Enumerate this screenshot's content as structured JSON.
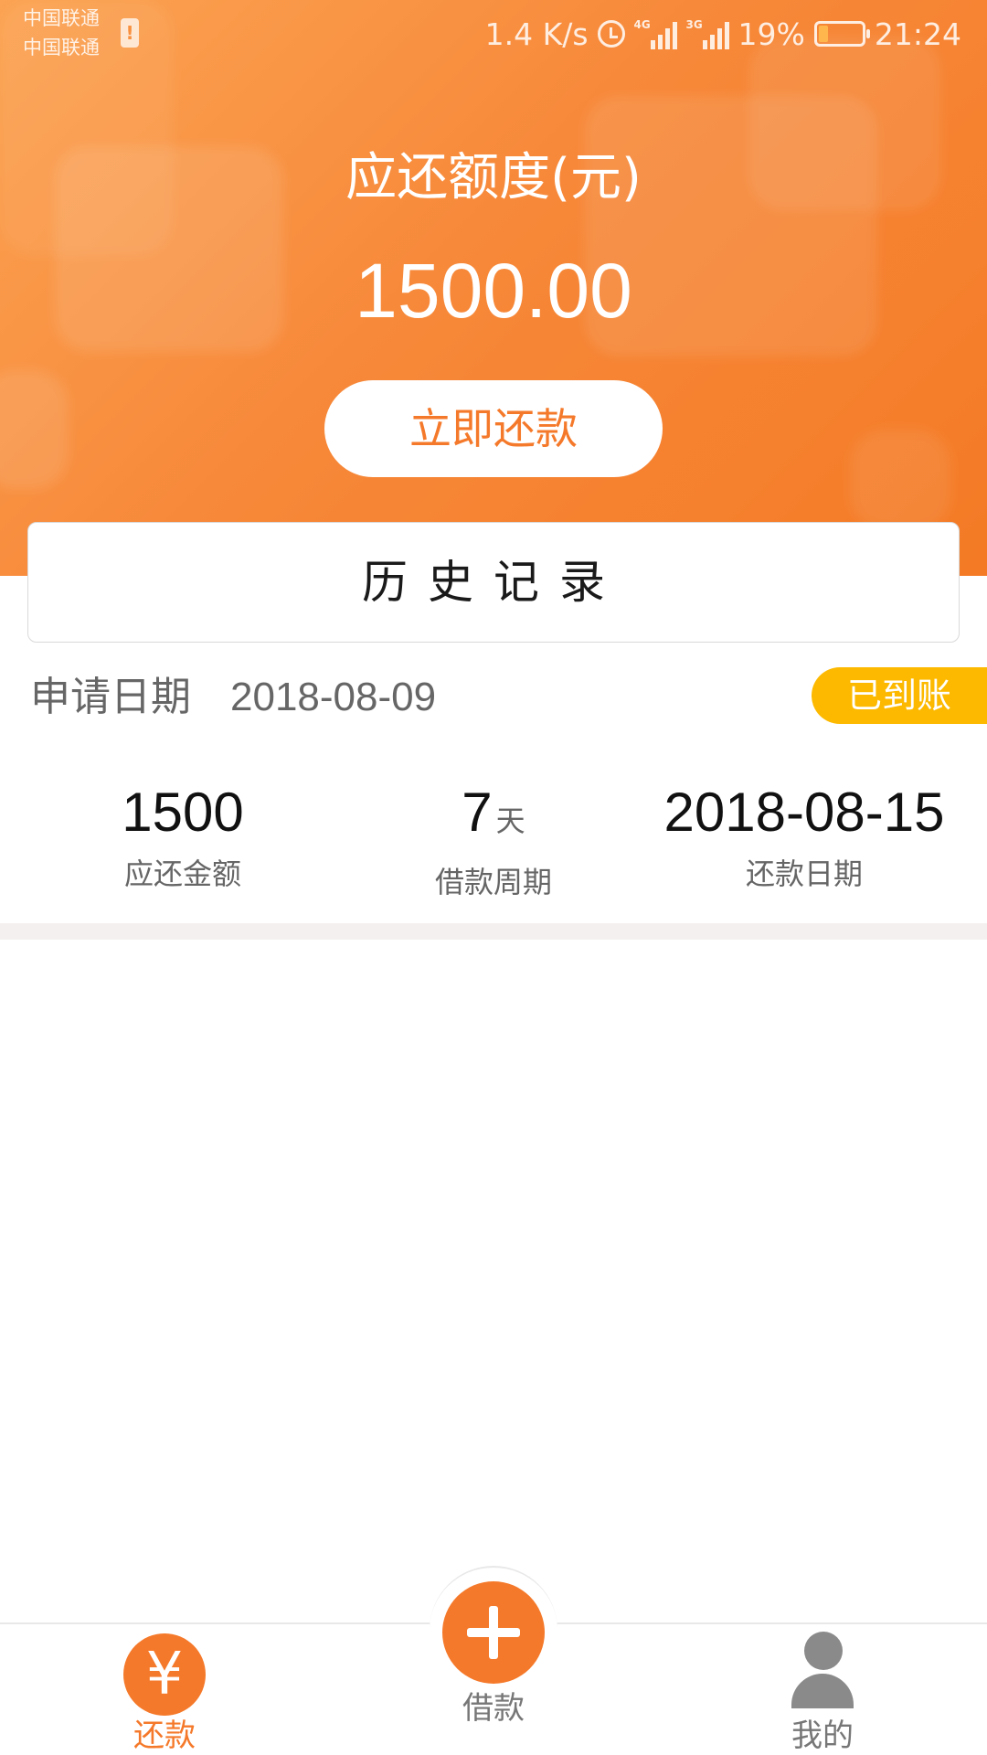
{
  "status_bar": {
    "carrier_1": "中国联通",
    "carrier_2": "中国联通",
    "net_speed": "1.4 K/s",
    "signal_1_type": "4G",
    "signal_2_type": "3G",
    "battery_percent": "19%",
    "time": "21:24"
  },
  "header": {
    "amount_label": "应还额度(元)",
    "amount_value": "1500.00",
    "repay_button_label": "立即还款"
  },
  "history": {
    "title": "历史记录"
  },
  "record": {
    "apply_label": "申请日期",
    "apply_date": "2018-08-09",
    "status": "已到账",
    "status_color": "#fcb900",
    "amount_value": "1500",
    "amount_label": "应还金额",
    "period_value": "7",
    "period_unit": "天",
    "period_label": "借款周期",
    "due_value": "2018-08-15",
    "due_label": "还款日期"
  },
  "tab_bar": {
    "repay_icon": "¥",
    "repay_label": "还款",
    "borrow_label": "借款",
    "mine_label": "我的",
    "active_tab": "还款",
    "accent_color": "#f5792a"
  }
}
